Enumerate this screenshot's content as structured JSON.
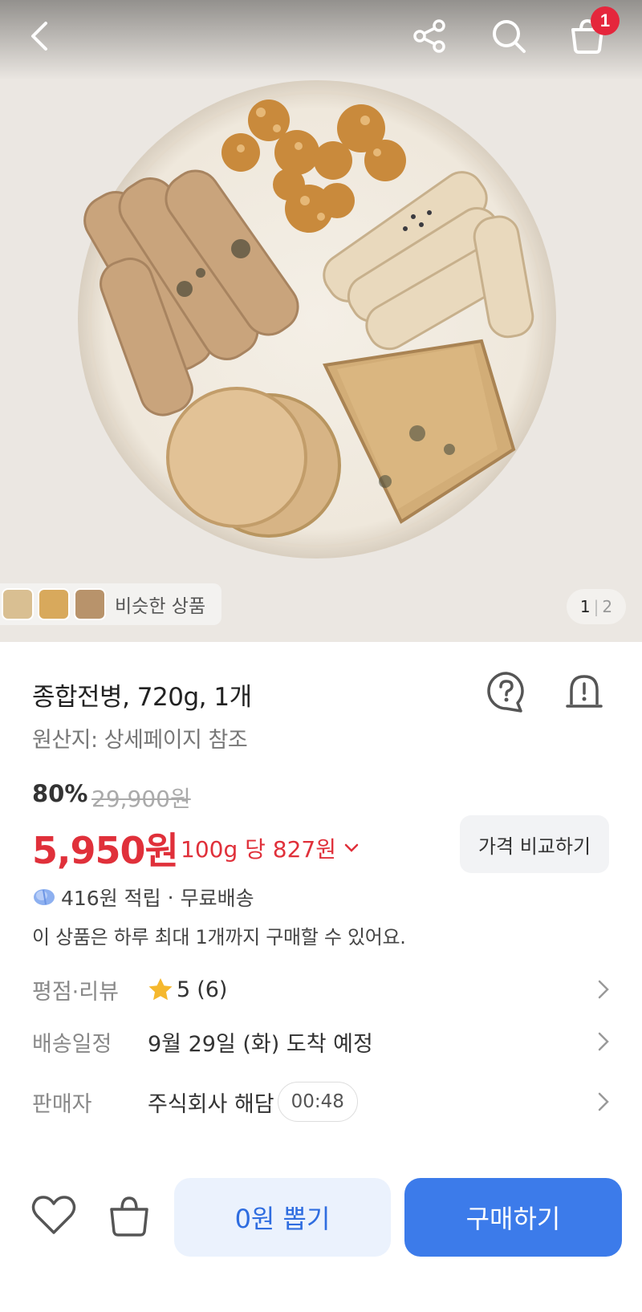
{
  "header": {
    "back_icon": "chevron-left-icon",
    "share_icon": "share-icon",
    "search_icon": "search-icon",
    "cart_icon": "shopping-bag-icon",
    "cart_badge": "1"
  },
  "gallery": {
    "similar_label": "비슷한 상품",
    "current_page": "1",
    "page_separator": "|",
    "total_pages": "2"
  },
  "product": {
    "title": "종합전병, 720g, 1개",
    "origin": "원산지: 상세페이지 참조",
    "discount": "80%",
    "original_price": "29,900원",
    "price": "5,950원",
    "unit_price": "100g 당 827원",
    "compare_label": "가격 비교하기",
    "reward": "416원 적립",
    "reward_separator": "·",
    "shipping": "무료배송",
    "purchase_limit": "이 상품은 하루 최대 1개까지 구매할 수 있어요."
  },
  "details": {
    "rating_label": "평점·리뷰",
    "rating_value": "5",
    "review_count": "(6)",
    "delivery_label": "배송일정",
    "delivery_value": "9월 29일 (화) 도착 예정",
    "seller_label": "판매자",
    "seller_value": "주식회사 해담",
    "seller_timer": "00:48"
  },
  "bottom_bar": {
    "wishlist_icon": "heart-icon",
    "cart_icon": "shopping-bag-icon",
    "draw_label": "0원 뽑기",
    "buy_label": "구매하기"
  },
  "colors": {
    "price_red": "#e0303a",
    "buy_blue": "#3c7bea",
    "draw_bg": "#ebf2fd",
    "badge_red": "#e5263c",
    "star": "#f5b82e"
  }
}
